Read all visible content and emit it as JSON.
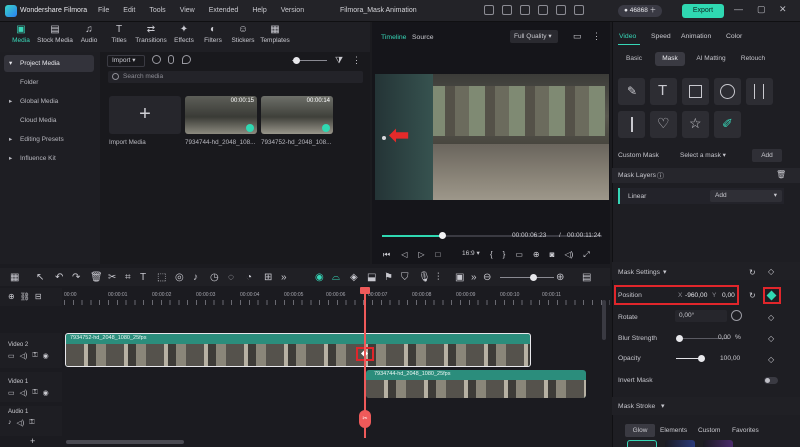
{
  "app": {
    "name": "Wondershare Filmora",
    "title": "Filmora_Mask Animation",
    "credits": "46868",
    "export_label": "Export"
  },
  "menu": [
    "File",
    "Edit",
    "Tools",
    "View",
    "Extended",
    "Help",
    "Version"
  ],
  "media_tabs": [
    "Media",
    "Stock Media",
    "Audio",
    "Titles",
    "Transitions",
    "Effects",
    "Filters",
    "Stickers",
    "Templates"
  ],
  "sidebar": {
    "items": [
      "Project Media",
      "Folder",
      "Global Media",
      "Cloud Media",
      "Editing Presets",
      "Influence Kit"
    ]
  },
  "media": {
    "import_label": "Import",
    "search_placeholder": "Search media",
    "import_media_label": "Import Media",
    "clips": [
      {
        "name": "7934744-hd_2048_108...",
        "duration": "00:00:15"
      },
      {
        "name": "7934752-hd_2048_108...",
        "duration": "00:00:14"
      }
    ]
  },
  "preview": {
    "tab_timeline": "Timeline",
    "tab_source": "Source",
    "quality": "Full Quality",
    "current_time": "00:00:06:23",
    "separator": "/",
    "total_time": "00:00:11:24",
    "ratio": "16:9"
  },
  "inspector": {
    "tabs": [
      "Video",
      "Speed",
      "Animation",
      "Color"
    ],
    "subtabs": [
      "Basic",
      "Mask",
      "AI Matting",
      "Retouch"
    ],
    "custom_mask_label": "Custom Mask",
    "select_mask": "Select a mask",
    "add_label": "Add",
    "mask_layers_label": "Mask Layers",
    "layer_name": "Linear",
    "layer_mode": "Add",
    "mask_settings_label": "Mask Settings",
    "position_label": "Position",
    "position_x_label": "X",
    "position_x": "-960,00",
    "position_y_label": "Y",
    "position_y": "0,00",
    "rotate_label": "Rotate",
    "rotate_value": "0,00°",
    "blur_label": "Blur Strength",
    "blur_value": "0,00",
    "blur_unit": "%",
    "opacity_label": "Opacity",
    "opacity_value": "100,00",
    "opacity_level": 1.0,
    "invert_label": "Invert Mask",
    "mask_stroke_label": "Mask Stroke",
    "stroke_tabs": [
      "Glow",
      "Elements",
      "Custom",
      "Favorites"
    ]
  },
  "timeline": {
    "ruler": [
      "00:00",
      "00:00:01",
      "00:00:02",
      "00:00:03",
      "00:00:04",
      "00:00:05",
      "00:00:06",
      "00:00:07",
      "00:00:08",
      "00:00:09",
      "00:00:10",
      "00:00:11"
    ],
    "tracks": [
      "Video 2",
      "Video 1",
      "Audio 1"
    ],
    "clip_top": "7934752-hd_2048_1080_25fps",
    "clip_bottom": "7934744-hd_2048_1080_25fps"
  },
  "colors": {
    "accent": "#2fd8b2",
    "clip": "#2b8d7c",
    "playhead": "#ef5a5a",
    "highlight": "#e0262b"
  }
}
